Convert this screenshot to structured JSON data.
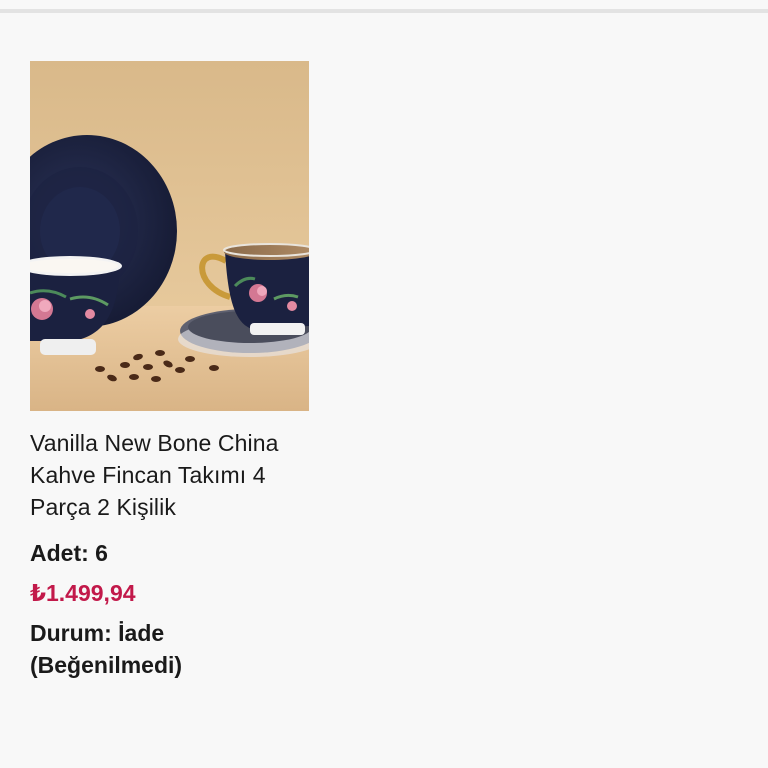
{
  "product": {
    "title": "Vanilla New Bone China Kahve Fincan Takımı 4 Parça 2 Kişilik",
    "quantity": "Adet: 6",
    "price": "₺1.499,94",
    "status": "Durum: İade (Beğenilmedi)",
    "price_color": "#c2194a",
    "image_icon": "coffee-cup-set-image"
  }
}
